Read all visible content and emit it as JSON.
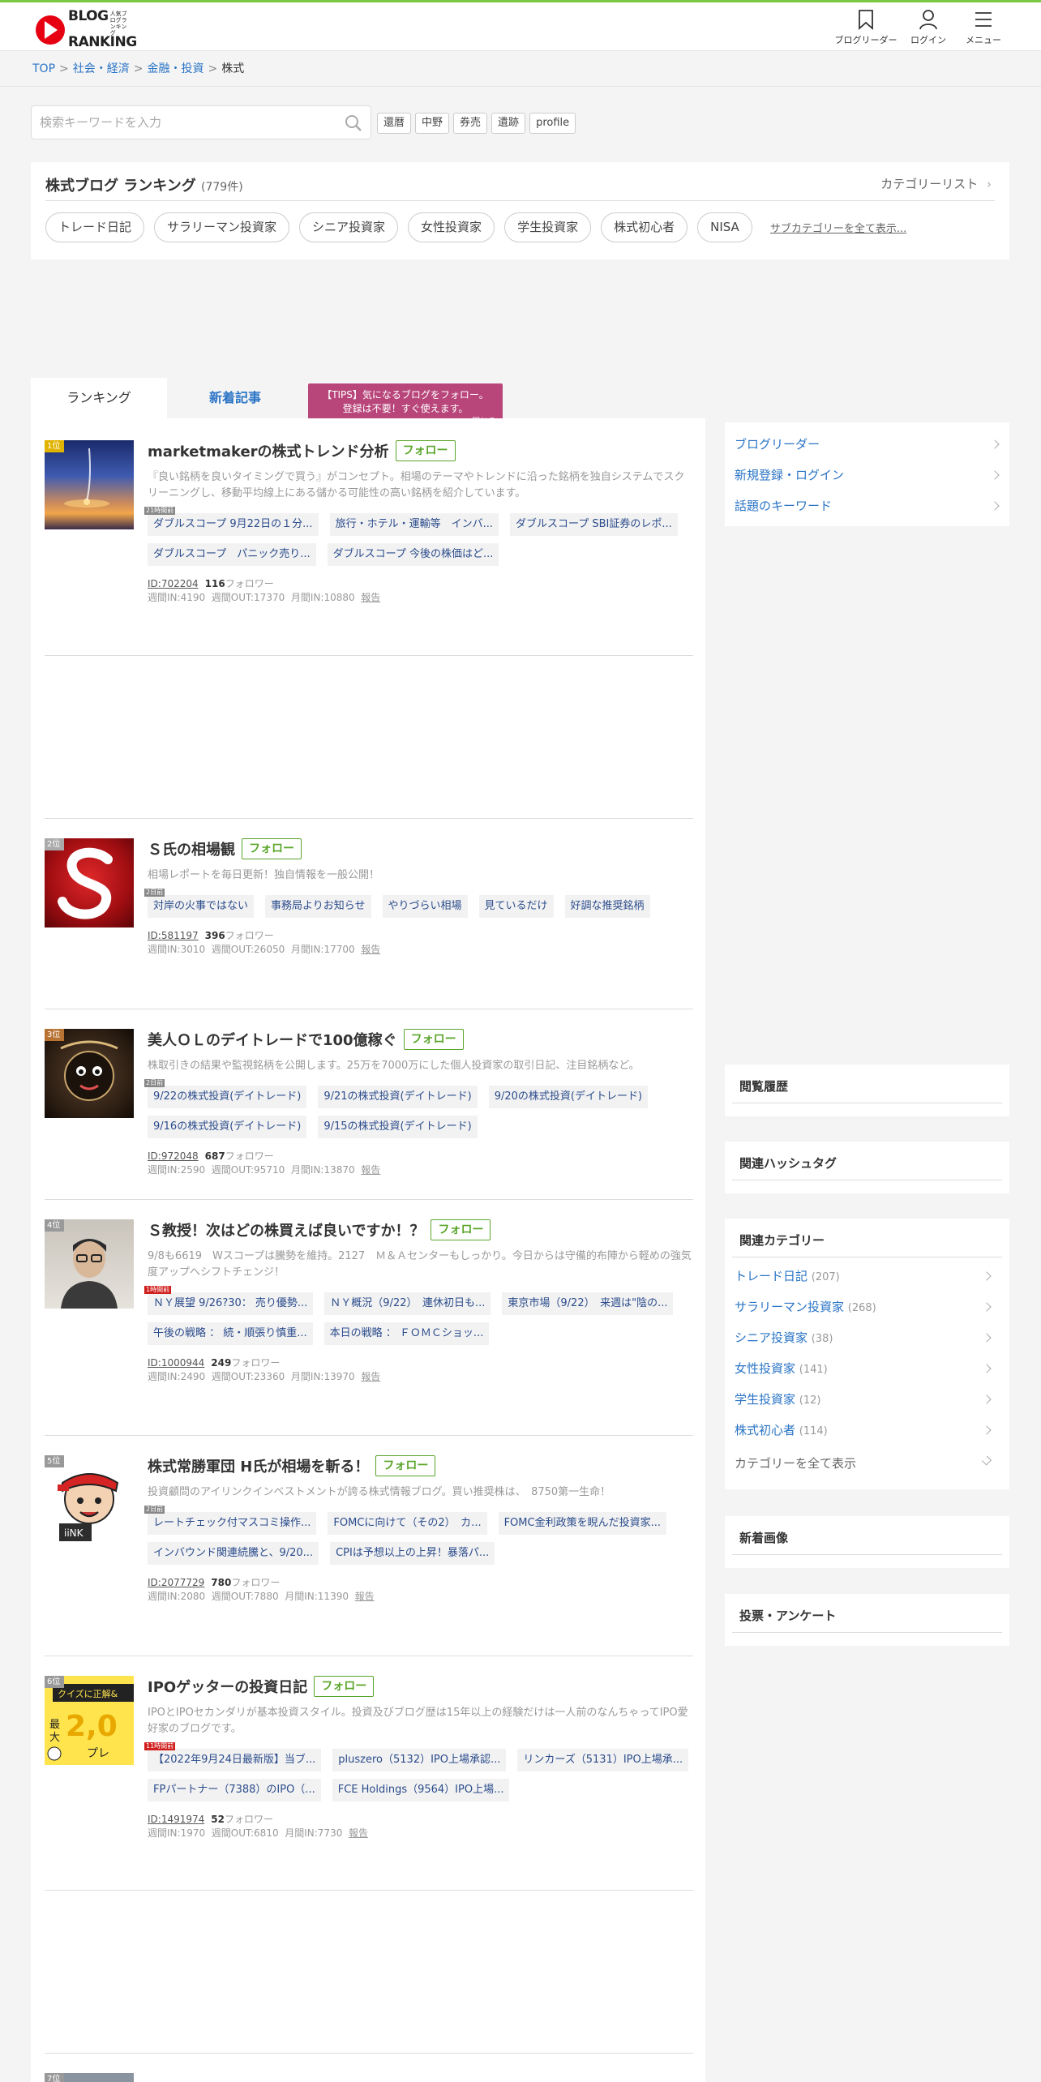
{
  "header": {
    "logo_text_top": "BLOG",
    "logo_text_bottom": "RANKING",
    "logo_tag": "人気ブログランキング",
    "bloglist_label": "ブログリーダー",
    "login_label": "ログイン",
    "menu_label": "メニュー"
  },
  "breadcrumb": [
    "TOP",
    "社会・経済",
    "金融・投資",
    "株式"
  ],
  "search": {
    "placeholder": "検索キーワードを入力",
    "keywords": [
      "還暦",
      "中野",
      "券売",
      "遺跡",
      "profile"
    ]
  },
  "category": {
    "title": "株式ブログ ランキング",
    "count": "(779件)",
    "list_link": "カテゴリーリスト",
    "pills": [
      "トレード日記",
      "サラリーマン投資家",
      "シニア投資家",
      "女性投資家",
      "学生投資家",
      "株式初心者",
      "NISA"
    ],
    "more_link": "サブカテゴリーを全て表示..."
  },
  "tabs": {
    "ranking": "ランキング",
    "new_posts": "新着記事"
  },
  "tip": {
    "line1": "【TIPS】気になるブログをフォロー。",
    "line2": "登録は不要！すぐ使えます。",
    "close": "閉じる"
  },
  "follow_label": "フォロー",
  "follower_word": "フォロワー",
  "weekly_in_label": "週間IN:",
  "weekly_out_label": "週間OUT:",
  "monthly_in_label": "月間IN:",
  "report_label": "報告",
  "entries": [
    {
      "rank": "1位",
      "name": "marketmakerの株式トレンド分析",
      "desc": "『良い銘柄を良いタイミングで買う』がコンセプト。相場のテーマやトレンドに沿った銘柄を独自システムでスクリーニングし、移動平均線上にある儲かる可能性の高い銘柄を紹介しています。",
      "ago": "21時間前",
      "posts": [
        "ダブルスコープ 9月22日の１分...",
        "旅行・ホテル・運輸等　インバ...",
        "ダブルスコープ SBI証券のレポ...",
        "ダブルスコープ　パニック売り...",
        "ダブルスコープ 今後の株価はど..."
      ],
      "id": "ID:702204",
      "followers": "116",
      "week_in": "4190",
      "week_out": "17370",
      "month_in": "10880"
    },
    {
      "rank": "2位",
      "name": "Ｓ氏の相場観",
      "desc": "相場レポートを毎日更新！独自情報を一般公開！",
      "ago": "2日前",
      "posts": [
        "対岸の火事ではない",
        "事務局よりお知らせ",
        "やりづらい相場",
        "見ているだけ",
        "好調な推奨銘柄"
      ],
      "id": "ID:581197",
      "followers": "396",
      "week_in": "3010",
      "week_out": "26050",
      "month_in": "17700"
    },
    {
      "rank": "3位",
      "name": "美人ＯＬのデイトレードで100億稼ぐ",
      "desc": "株取引きの結果や監視銘柄を公開します。25万を7000万にした個人投資家の取引日記、注目銘柄など。",
      "ago": "2日前",
      "posts": [
        "9/22の株式投資(デイトレード)",
        "9/21の株式投資(デイトレード)",
        "9/20の株式投資(デイトレード)",
        "9/16の株式投資(デイトレード)",
        "9/15の株式投資(デイトレード)"
      ],
      "id": "ID:972048",
      "followers": "687",
      "week_in": "2590",
      "week_out": "95710",
      "month_in": "13870"
    },
    {
      "rank": "4位",
      "name": "Ｓ教授！次はどの株買えば良いですか！？",
      "desc": "9/8も6619　Wスコープは騰勢を維持。2127　Ｍ＆Ａセンターもしっかり。今日からは守備的布陣から軽めの強気度アップへシフトチェンジ！",
      "ago": "1時間前",
      "ago_red": true,
      "posts": [
        "ＮＹ展望 9/26?30： 売り優勢...",
        "ＮＹ概況（9/22）　連休初日も...",
        "東京市場（9/22）　来週は\"陰の...",
        "午後の戦略 ： 続・順張り慎重...",
        "本日の戦略 ： ＦＯＭＣショッ..."
      ],
      "id": "ID:1000944",
      "followers": "249",
      "week_in": "2490",
      "week_out": "23360",
      "month_in": "13970"
    },
    {
      "rank": "5位",
      "name": "株式常勝軍団 H氏が相場を斬る！",
      "desc": "投資顧問のアイリンクインベストメントが誇る株式情報ブログ。買い推奨株は、　8750第一生命！",
      "ago": "2日前",
      "posts": [
        "レートチェック付マスコミ操作...",
        "FOMCに向けて（その2）　カ...",
        "FOMC金利政策を睨んだ投資家...",
        "インバウンド関連続騰と、9/20...",
        "CPIは予想以上の上昇！暴落パ..."
      ],
      "id": "ID:2077729",
      "followers": "780",
      "week_in": "2080",
      "week_out": "7880",
      "month_in": "11390"
    },
    {
      "rank": "6位",
      "name": "IPOゲッターの投資日記",
      "desc": "IPOとIPOセカンダリが基本投資スタイル。投資及びブログ歴は15年以上の経験だけは一人前のなんちゃってIPO愛好家のブログです。",
      "ago": "11時間前",
      "ago_red": true,
      "posts": [
        "【2022年9月24日最新版】当ブ...",
        "pluszero（5132）IPO上場承認...",
        "リンカーズ（5131）IPO上場承...",
        "FPパートナー（7388）のIPO（...",
        "FCE Holdings（9564）IPO上場..."
      ],
      "id": "ID:1491974",
      "followers": "52",
      "week_in": "1970",
      "week_out": "6810",
      "month_in": "7730"
    },
    {
      "rank": "7位"
    }
  ],
  "sidebar": {
    "links": [
      "ブログリーダー",
      "新規登録・ログイン",
      "話題のキーワード"
    ],
    "history_title": "閲覧履歴",
    "hashtag_title": "関連ハッシュタグ",
    "related_title": "関連カテゴリー",
    "related": [
      {
        "name": "トレード日記",
        "count": "(207)"
      },
      {
        "name": "サラリーマン投資家",
        "count": "(268)"
      },
      {
        "name": "シニア投資家",
        "count": "(38)"
      },
      {
        "name": "女性投資家",
        "count": "(141)"
      },
      {
        "name": "学生投資家",
        "count": "(12)"
      },
      {
        "name": "株式初心者",
        "count": "(114)"
      }
    ],
    "all_categories": "カテゴリーを全て表示",
    "new_images_title": "新着画像",
    "poll_title": "投票・アンケート"
  },
  "colors": {
    "accent_green": "#7ac943",
    "link_blue": "#2a74c6",
    "follow_green": "#5aa52a",
    "tip_magenta": "#b8467a"
  }
}
